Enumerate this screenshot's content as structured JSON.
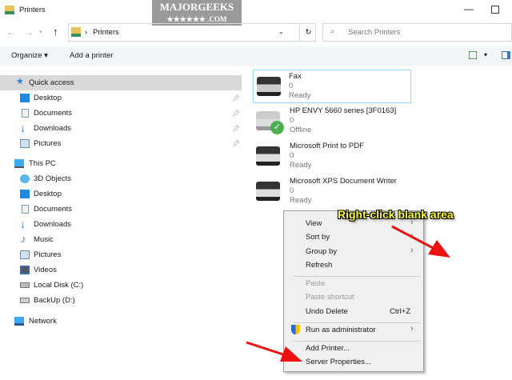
{
  "window": {
    "title": "Printers",
    "watermark": "MAJORGEEKS .COM"
  },
  "address": {
    "path": "Printers",
    "search_placeholder": "Search Printers"
  },
  "toolbar": {
    "organize": "Organize ▾",
    "add_printer": "Add a printer"
  },
  "sidebar": {
    "quick_access": "Quick access",
    "quick_items": [
      "Desktop",
      "Documents",
      "Downloads",
      "Pictures"
    ],
    "this_pc": "This PC",
    "pc_items": [
      "3D Objects",
      "Desktop",
      "Documents",
      "Downloads",
      "Music",
      "Pictures",
      "Videos",
      "Local Disk (C:)",
      "BackUp (D:)"
    ],
    "network": "Network"
  },
  "printers": [
    {
      "name": "Fax",
      "jobs": "0",
      "status": "Ready"
    },
    {
      "name": "HP ENVY 5660 series [3F0163]",
      "jobs": "0",
      "status": "Offline"
    },
    {
      "name": "Microsoft Print to PDF",
      "jobs": "0",
      "status": "Ready"
    },
    {
      "name": "Microsoft XPS Document Writer",
      "jobs": "0",
      "status": "Ready"
    }
  ],
  "context_menu": {
    "view": "View",
    "sort_by": "Sort by",
    "group_by": "Group by",
    "refresh": "Refresh",
    "paste": "Paste",
    "paste_shortcut": "Paste shortcut",
    "undo_delete": "Undo Delete",
    "undo_shortcut": "Ctrl+Z",
    "run_as_admin": "Run as administrator",
    "add_printer": "Add Printer...",
    "server_properties": "Server Properties..."
  },
  "annotation": {
    "text": "Right-click blank area",
    "color": "#ffff33",
    "arrow_color": "#ee1111"
  }
}
